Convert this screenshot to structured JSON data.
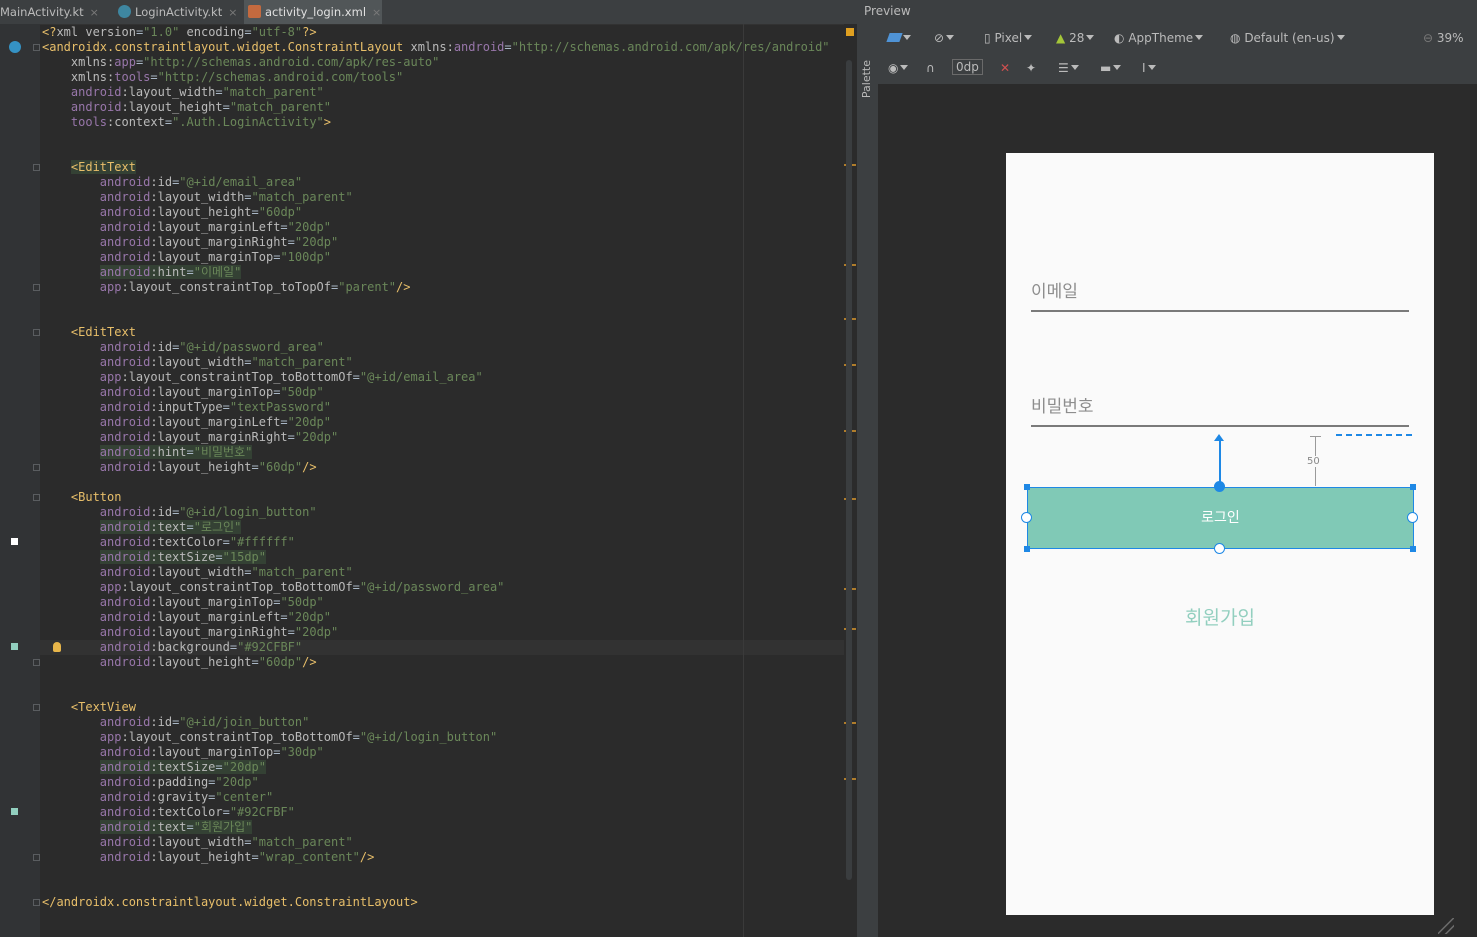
{
  "tabs": [
    {
      "label": "MainActivity.kt",
      "close": "×",
      "icon": "kotlin-class-icon",
      "active": false
    },
    {
      "label": "LoginActivity.kt",
      "close": "×",
      "icon": "kotlin-class-icon",
      "active": false
    },
    {
      "label": "activity_login.xml",
      "close": "×",
      "icon": "xml-layout-icon",
      "active": true
    }
  ],
  "code_lines": [
    [
      {
        "c": "p",
        "s": "<?"
      },
      {
        "c": "a",
        "s": "xml version"
      },
      {
        "c": "",
        "s": "="
      },
      {
        "c": "v",
        "s": "\"1.0\""
      },
      {
        "c": "a",
        "s": " encoding"
      },
      {
        "c": "",
        "s": "="
      },
      {
        "c": "v",
        "s": "\"utf-8\""
      },
      {
        "c": "p",
        "s": "?>"
      }
    ],
    [
      {
        "c": "t",
        "s": "<androidx.constraintlayout.widget.ConstraintLayout "
      },
      {
        "c": "a",
        "s": "xmlns:"
      },
      {
        "c": "ns",
        "s": "android"
      },
      {
        "c": "",
        "s": "="
      },
      {
        "c": "v",
        "s": "\"http://schemas.android.com/apk/res/android\""
      }
    ],
    [
      {
        "c": "a",
        "s": "    xmlns:"
      },
      {
        "c": "ns",
        "s": "app"
      },
      {
        "c": "",
        "s": "="
      },
      {
        "c": "v",
        "s": "\"http://schemas.android.com/apk/res-auto\""
      }
    ],
    [
      {
        "c": "a",
        "s": "    xmlns:"
      },
      {
        "c": "ns",
        "s": "tools"
      },
      {
        "c": "",
        "s": "="
      },
      {
        "c": "v",
        "s": "\"http://schemas.android.com/tools\""
      }
    ],
    [
      {
        "c": "ns",
        "s": "    android"
      },
      {
        "c": "a",
        "s": ":layout_width"
      },
      {
        "c": "",
        "s": "="
      },
      {
        "c": "v",
        "s": "\"match_parent\""
      }
    ],
    [
      {
        "c": "ns",
        "s": "    android"
      },
      {
        "c": "a",
        "s": ":layout_height"
      },
      {
        "c": "",
        "s": "="
      },
      {
        "c": "v",
        "s": "\"match_parent\""
      }
    ],
    [
      {
        "c": "ns",
        "s": "    tools"
      },
      {
        "c": "a",
        "s": ":context"
      },
      {
        "c": "",
        "s": "="
      },
      {
        "c": "v",
        "s": "\".Auth.LoginActivity\""
      },
      {
        "c": "t",
        "s": ">"
      }
    ],
    [],
    [],
    [
      {
        "c": "",
        "s": "    "
      },
      {
        "c": "t hl",
        "s": "<EditText"
      }
    ],
    [
      {
        "c": "ns",
        "s": "        android"
      },
      {
        "c": "a",
        "s": ":id"
      },
      {
        "c": "",
        "s": "="
      },
      {
        "c": "v",
        "s": "\"@+id/email_area\""
      }
    ],
    [
      {
        "c": "ns",
        "s": "        android"
      },
      {
        "c": "a",
        "s": ":layout_width"
      },
      {
        "c": "",
        "s": "="
      },
      {
        "c": "v",
        "s": "\"match_parent\""
      }
    ],
    [
      {
        "c": "ns",
        "s": "        android"
      },
      {
        "c": "a",
        "s": ":layout_height"
      },
      {
        "c": "",
        "s": "="
      },
      {
        "c": "v",
        "s": "\"60dp\""
      }
    ],
    [
      {
        "c": "ns",
        "s": "        android"
      },
      {
        "c": "a",
        "s": ":layout_marginLeft"
      },
      {
        "c": "",
        "s": "="
      },
      {
        "c": "v",
        "s": "\"20dp\""
      }
    ],
    [
      {
        "c": "ns",
        "s": "        android"
      },
      {
        "c": "a",
        "s": ":layout_marginRight"
      },
      {
        "c": "",
        "s": "="
      },
      {
        "c": "v",
        "s": "\"20dp\""
      }
    ],
    [
      {
        "c": "ns",
        "s": "        android"
      },
      {
        "c": "a",
        "s": ":layout_marginTop"
      },
      {
        "c": "",
        "s": "="
      },
      {
        "c": "v",
        "s": "\"100dp\""
      }
    ],
    [
      {
        "c": "",
        "s": "        "
      },
      {
        "c": "ns hl",
        "s": "android"
      },
      {
        "c": "a hl",
        "s": ":hint"
      },
      {
        "c": "hl",
        "s": "="
      },
      {
        "c": "v hl",
        "s": "\"이메일\""
      }
    ],
    [
      {
        "c": "ns",
        "s": "        app"
      },
      {
        "c": "a",
        "s": ":layout_constraintTop_toTopOf"
      },
      {
        "c": "",
        "s": "="
      },
      {
        "c": "v",
        "s": "\"parent\""
      },
      {
        "c": "t",
        "s": "/>"
      }
    ],
    [],
    [],
    [
      {
        "c": "",
        "s": "    "
      },
      {
        "c": "t",
        "s": "<EditText"
      }
    ],
    [
      {
        "c": "ns",
        "s": "        android"
      },
      {
        "c": "a",
        "s": ":id"
      },
      {
        "c": "",
        "s": "="
      },
      {
        "c": "v",
        "s": "\"@+id/password_area\""
      }
    ],
    [
      {
        "c": "ns",
        "s": "        android"
      },
      {
        "c": "a",
        "s": ":layout_width"
      },
      {
        "c": "",
        "s": "="
      },
      {
        "c": "v",
        "s": "\"match_parent\""
      }
    ],
    [
      {
        "c": "ns",
        "s": "        app"
      },
      {
        "c": "a",
        "s": ":layout_constraintTop_toBottomOf"
      },
      {
        "c": "",
        "s": "="
      },
      {
        "c": "v",
        "s": "\"@+id/email_area\""
      }
    ],
    [
      {
        "c": "ns",
        "s": "        android"
      },
      {
        "c": "a",
        "s": ":layout_marginTop"
      },
      {
        "c": "",
        "s": "="
      },
      {
        "c": "v",
        "s": "\"50dp\""
      }
    ],
    [
      {
        "c": "ns",
        "s": "        android"
      },
      {
        "c": "a",
        "s": ":inputType"
      },
      {
        "c": "",
        "s": "="
      },
      {
        "c": "v",
        "s": "\"textPassword\""
      }
    ],
    [
      {
        "c": "ns",
        "s": "        android"
      },
      {
        "c": "a",
        "s": ":layout_marginLeft"
      },
      {
        "c": "",
        "s": "="
      },
      {
        "c": "v",
        "s": "\"20dp\""
      }
    ],
    [
      {
        "c": "ns",
        "s": "        android"
      },
      {
        "c": "a",
        "s": ":layout_marginRight"
      },
      {
        "c": "",
        "s": "="
      },
      {
        "c": "v",
        "s": "\"20dp\""
      }
    ],
    [
      {
        "c": "",
        "s": "        "
      },
      {
        "c": "ns hl",
        "s": "android"
      },
      {
        "c": "a hl",
        "s": ":hint"
      },
      {
        "c": "hl",
        "s": "="
      },
      {
        "c": "v hl",
        "s": "\"비밀번호\""
      }
    ],
    [
      {
        "c": "ns",
        "s": "        android"
      },
      {
        "c": "a",
        "s": ":layout_height"
      },
      {
        "c": "",
        "s": "="
      },
      {
        "c": "v",
        "s": "\"60dp\""
      },
      {
        "c": "t",
        "s": "/>"
      }
    ],
    [],
    [
      {
        "c": "",
        "s": "    "
      },
      {
        "c": "t",
        "s": "<Button"
      }
    ],
    [
      {
        "c": "ns",
        "s": "        android"
      },
      {
        "c": "a",
        "s": ":id"
      },
      {
        "c": "",
        "s": "="
      },
      {
        "c": "v",
        "s": "\"@+id/login_button\""
      }
    ],
    [
      {
        "c": "",
        "s": "        "
      },
      {
        "c": "ns hl",
        "s": "android"
      },
      {
        "c": "a hl",
        "s": ":text"
      },
      {
        "c": "hl",
        "s": "="
      },
      {
        "c": "v hl",
        "s": "\"로그인\""
      }
    ],
    [
      {
        "c": "ns",
        "s": "        android"
      },
      {
        "c": "a",
        "s": ":textColor"
      },
      {
        "c": "",
        "s": "="
      },
      {
        "c": "v",
        "s": "\"#ffffff\""
      }
    ],
    [
      {
        "c": "",
        "s": "        "
      },
      {
        "c": "ns hl",
        "s": "android"
      },
      {
        "c": "a hl",
        "s": ":textSize"
      },
      {
        "c": "hl",
        "s": "="
      },
      {
        "c": "v hl",
        "s": "\"15dp\""
      }
    ],
    [
      {
        "c": "ns",
        "s": "        android"
      },
      {
        "c": "a",
        "s": ":layout_width"
      },
      {
        "c": "",
        "s": "="
      },
      {
        "c": "v",
        "s": "\"match_parent\""
      }
    ],
    [
      {
        "c": "ns",
        "s": "        app"
      },
      {
        "c": "a",
        "s": ":layout_constraintTop_toBottomOf"
      },
      {
        "c": "",
        "s": "="
      },
      {
        "c": "v",
        "s": "\"@+id/password_area\""
      }
    ],
    [
      {
        "c": "ns",
        "s": "        android"
      },
      {
        "c": "a",
        "s": ":layout_marginTop"
      },
      {
        "c": "",
        "s": "="
      },
      {
        "c": "v",
        "s": "\"50dp\""
      }
    ],
    [
      {
        "c": "ns",
        "s": "        android"
      },
      {
        "c": "a",
        "s": ":layout_marginLeft"
      },
      {
        "c": "",
        "s": "="
      },
      {
        "c": "v",
        "s": "\"20dp\""
      }
    ],
    [
      {
        "c": "ns",
        "s": "        android"
      },
      {
        "c": "a",
        "s": ":layout_marginRight"
      },
      {
        "c": "",
        "s": "="
      },
      {
        "c": "v",
        "s": "\"20dp\""
      }
    ],
    [
      {
        "c": "ns",
        "s": "        android"
      },
      {
        "c": "a",
        "s": ":background"
      },
      {
        "c": "",
        "s": "="
      },
      {
        "c": "v",
        "s": "\"#92CFBF\""
      }
    ],
    [
      {
        "c": "ns",
        "s": "        android"
      },
      {
        "c": "a",
        "s": ":layout_height"
      },
      {
        "c": "",
        "s": "="
      },
      {
        "c": "v",
        "s": "\"60dp\""
      },
      {
        "c": "t",
        "s": "/>"
      }
    ],
    [],
    [],
    [
      {
        "c": "",
        "s": "    "
      },
      {
        "c": "t",
        "s": "<TextView"
      }
    ],
    [
      {
        "c": "ns",
        "s": "        android"
      },
      {
        "c": "a",
        "s": ":id"
      },
      {
        "c": "",
        "s": "="
      },
      {
        "c": "v",
        "s": "\"@+id/join_button\""
      }
    ],
    [
      {
        "c": "ns",
        "s": "        app"
      },
      {
        "c": "a",
        "s": ":layout_constraintTop_toBottomOf"
      },
      {
        "c": "",
        "s": "="
      },
      {
        "c": "v",
        "s": "\"@+id/login_button\""
      }
    ],
    [
      {
        "c": "ns",
        "s": "        android"
      },
      {
        "c": "a",
        "s": ":layout_marginTop"
      },
      {
        "c": "",
        "s": "="
      },
      {
        "c": "v",
        "s": "\"30dp\""
      }
    ],
    [
      {
        "c": "",
        "s": "        "
      },
      {
        "c": "ns hl",
        "s": "android"
      },
      {
        "c": "a hl",
        "s": ":textSize"
      },
      {
        "c": "hl",
        "s": "="
      },
      {
        "c": "v hl",
        "s": "\"20dp\""
      }
    ],
    [
      {
        "c": "ns",
        "s": "        android"
      },
      {
        "c": "a",
        "s": ":padding"
      },
      {
        "c": "",
        "s": "="
      },
      {
        "c": "v",
        "s": "\"20dp\""
      }
    ],
    [
      {
        "c": "ns",
        "s": "        android"
      },
      {
        "c": "a",
        "s": ":gravity"
      },
      {
        "c": "",
        "s": "="
      },
      {
        "c": "v",
        "s": "\"center\""
      }
    ],
    [
      {
        "c": "ns",
        "s": "        android"
      },
      {
        "c": "a",
        "s": ":textColor"
      },
      {
        "c": "",
        "s": "="
      },
      {
        "c": "v",
        "s": "\"#92CFBF\""
      }
    ],
    [
      {
        "c": "",
        "s": "        "
      },
      {
        "c": "ns hl",
        "s": "android"
      },
      {
        "c": "a hl",
        "s": ":text"
      },
      {
        "c": "hl",
        "s": "="
      },
      {
        "c": "v hl",
        "s": "\"회원가입\""
      }
    ],
    [
      {
        "c": "ns",
        "s": "        android"
      },
      {
        "c": "a",
        "s": ":layout_width"
      },
      {
        "c": "",
        "s": "="
      },
      {
        "c": "v",
        "s": "\"match_parent\""
      }
    ],
    [
      {
        "c": "ns",
        "s": "        android"
      },
      {
        "c": "a",
        "s": ":layout_height"
      },
      {
        "c": "",
        "s": "="
      },
      {
        "c": "v",
        "s": "\"wrap_content\""
      },
      {
        "c": "t",
        "s": "/>"
      }
    ],
    [],
    [],
    [
      {
        "c": "t",
        "s": "</androidx.constraintlayout.widget.ConstraintLayout>"
      }
    ]
  ],
  "preview": {
    "title": "Preview",
    "palette_label": "Palette",
    "toolbar": {
      "device": "Pixel",
      "api": "28",
      "theme": "AppTheme",
      "locale": "Default (en-us)",
      "zoom": "39%",
      "margin": "0dp"
    },
    "screen": {
      "email_hint": "이메일",
      "password_hint": "비밀번호",
      "login_label": "로그인",
      "join_label": "회원가입",
      "margin_readout": "50"
    }
  },
  "colors": {
    "button_bg": "#92CFBF",
    "join_text": "#92CFBF",
    "selection": "#1e88e5",
    "editor_bg": "#2b2b2b"
  }
}
